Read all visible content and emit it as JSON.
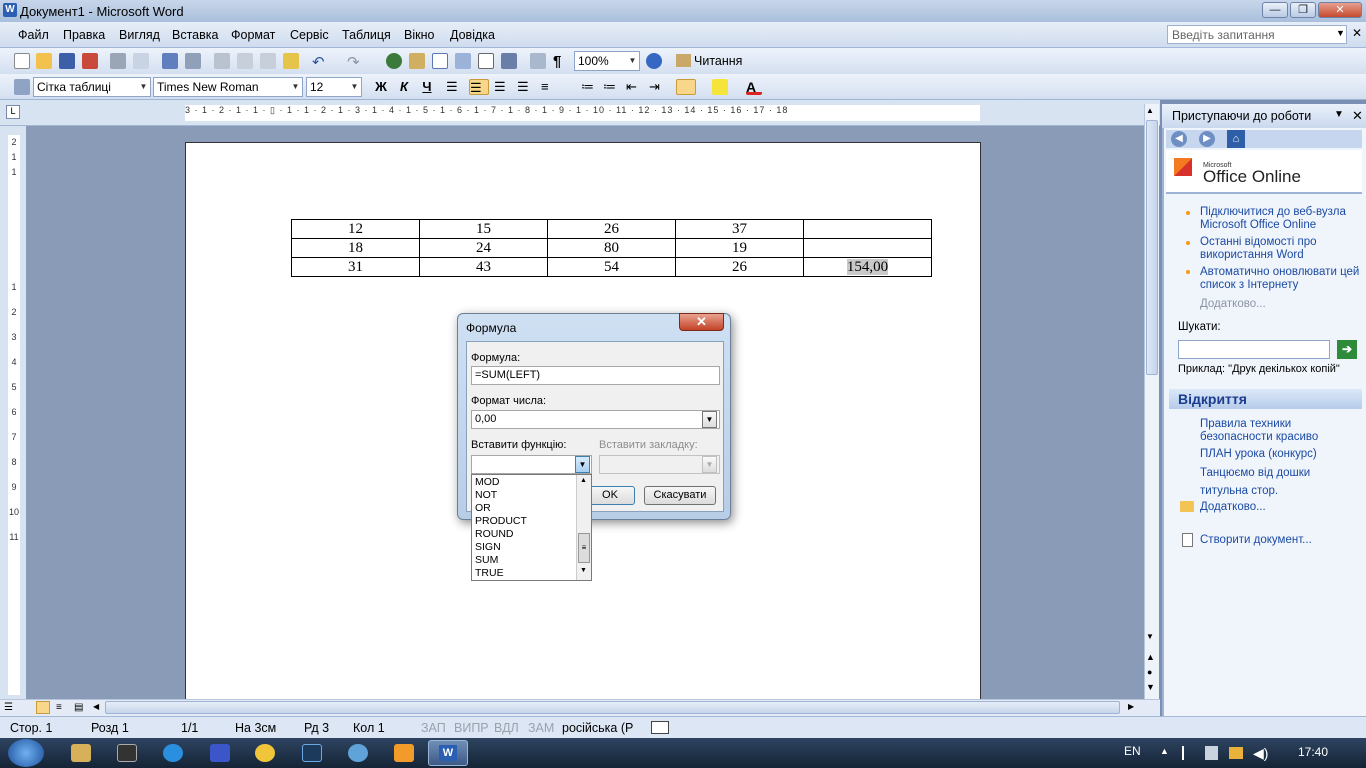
{
  "window": {
    "title": "Документ1 - Microsoft Word"
  },
  "menu": [
    "Файл",
    "Правка",
    "Вигляд",
    "Вставка",
    "Формат",
    "Сервіс",
    "Таблиця",
    "Вікно",
    "Довідка"
  ],
  "ask": {
    "placeholder": "Введіть запитання"
  },
  "toolbar": {
    "zoom": "100%",
    "reading": "Читання",
    "style": "Сітка таблиці",
    "font": "Times New Roman",
    "size": "12",
    "bold": "Ж",
    "italic": "К",
    "underline": "Ч"
  },
  "ruler": {
    "marks": "3 · 1 · 2 · 1 · 1 · ▯ · 1 · 1 · 2 · 1 · 3 · 1 · 4 · 1 · 5 · 1 · 6 · 1 · 7 · 1 · 8 · 1 · 9 · 1 · 10 · 11 · 12 · 13 · 14 · 15 · 16 · 17 · 18"
  },
  "vruler": [
    "2",
    "1",
    "1",
    "",
    "1",
    "2",
    "3",
    "4",
    "5",
    "6",
    "7",
    "8",
    "9",
    "10",
    "11",
    "12"
  ],
  "table": {
    "rows": [
      [
        "12",
        "15",
        "26",
        "37",
        ""
      ],
      [
        "18",
        "24",
        "80",
        "19",
        ""
      ],
      [
        "31",
        "43",
        "54",
        "26",
        "154,00"
      ]
    ]
  },
  "dialog": {
    "title": "Формула",
    "close": "✕",
    "formula_label": "Формула:",
    "formula_value": "=SUM(LEFT)",
    "format_label": "Формат числа:",
    "format_value": "0,00",
    "function_label": "Вставити функцію:",
    "bookmark_label": "Вставити закладку:",
    "ok": "OK",
    "cancel": "Скасувати",
    "functions": [
      "MOD",
      "NOT",
      "OR",
      "PRODUCT",
      "ROUND",
      "SIGN",
      "SUM",
      "TRUE"
    ]
  },
  "pane": {
    "title": "Приступаючи до роботи",
    "brand_small": "Microsoft",
    "brand": "Office Online",
    "links": [
      "Підключитися до веб-вузла Microsoft Office Online",
      "Останні відомості про використання Word",
      "Автоматично оновлювати цей список з Інтернету"
    ],
    "more": "Додатково...",
    "search_label": "Шукати:",
    "example": "Приклад:  \"Друк декількох копій\"",
    "open_header": "Відкриття",
    "recent": [
      "Правила техники безопасности красиво",
      "ПЛАН урока (конкурс)",
      "Танцюємо від дошки",
      "титульна стор."
    ],
    "more2": "Додатково...",
    "create": "Створити документ..."
  },
  "status": {
    "page": "Стор.  1",
    "section": "Розд  1",
    "pages": "1/1",
    "at": "На  3см",
    "line": "Рд  3",
    "col": "Кол  1",
    "rec": "ЗАП",
    "trk": "ВИПР",
    "ext": "ВДЛ",
    "ovr": "ЗАМ",
    "lang": "російська (Р"
  },
  "tray": {
    "lang": "EN",
    "time": "17:40"
  },
  "colors": {
    "accent": "#1b4aa3",
    "titlebar": "#b5c8e2",
    "dialog_close": "#c24226"
  }
}
